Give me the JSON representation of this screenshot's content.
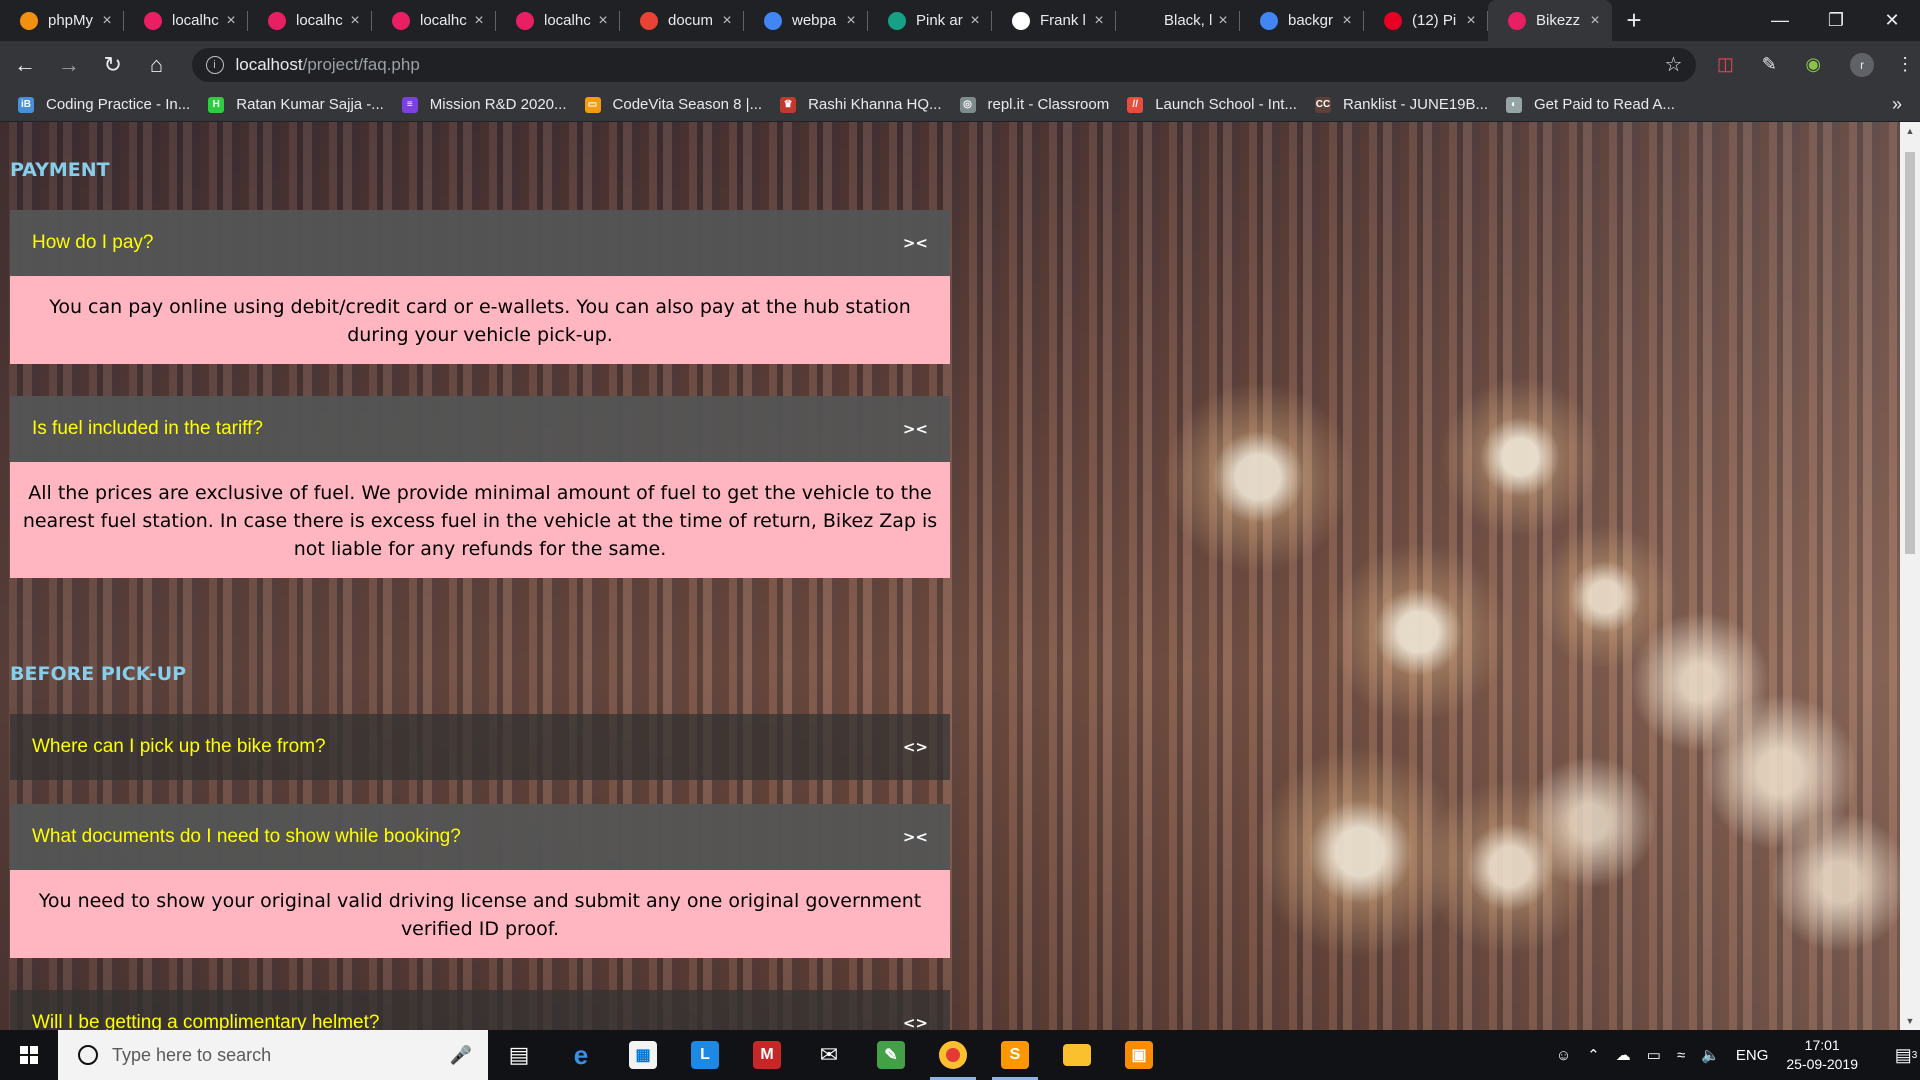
{
  "browser": {
    "tabs": [
      {
        "title": "phpMy",
        "icon": "phpmyadmin-icon",
        "color": "#f29111"
      },
      {
        "title": "localhc",
        "icon": "localhost-icon",
        "color": "#e91e63"
      },
      {
        "title": "localhc",
        "icon": "localhost-icon",
        "color": "#e91e63"
      },
      {
        "title": "localhc",
        "icon": "localhost-icon",
        "color": "#e91e63"
      },
      {
        "title": "localhc",
        "icon": "localhost-icon",
        "color": "#e91e63"
      },
      {
        "title": "docum",
        "icon": "gmail-icon",
        "color": "#ea4335"
      },
      {
        "title": "webpa",
        "icon": "google-icon",
        "color": "#4285f4"
      },
      {
        "title": "Pink ar",
        "icon": "docs-icon",
        "color": "#16a085"
      },
      {
        "title": "Frank l",
        "icon": "bookmark-icon",
        "color": "#ffffff"
      },
      {
        "title": "Black, l",
        "icon": "blank-icon",
        "color": "#202124"
      },
      {
        "title": "backgr",
        "icon": "google-icon",
        "color": "#4285f4"
      },
      {
        "title": "(12) Pi",
        "icon": "pinterest-icon",
        "color": "#e60023"
      },
      {
        "title": "Bikezz",
        "icon": "localhost-icon",
        "color": "#e91e63"
      }
    ],
    "url_host": "localhost",
    "url_path": "/project/faq.php",
    "profile_initial": "r",
    "bookmarks": [
      {
        "label": "Coding Practice - In...",
        "color": "#4a90d9",
        "glyph": "iB"
      },
      {
        "label": "Ratan Kumar Sajja -...",
        "color": "#2ecc40",
        "glyph": "H"
      },
      {
        "label": "Mission R&D 2020...",
        "color": "#7b3fe4",
        "glyph": "≡"
      },
      {
        "label": "CodeVita Season 8 |...",
        "color": "#f39c12",
        "glyph": "▭"
      },
      {
        "label": "Rashi Khanna HQ...",
        "color": "#c0392b",
        "glyph": "♛"
      },
      {
        "label": "repl.it - Classroom",
        "color": "#7f8c8d",
        "glyph": "◎"
      },
      {
        "label": "Launch School - Int...",
        "color": "#e74c3c",
        "glyph": "//"
      },
      {
        "label": "Ranklist - JUNE19B...",
        "color": "#5d4037",
        "glyph": "CC"
      },
      {
        "label": "Get Paid to Read A...",
        "color": "#95a5a6",
        "glyph": "◐"
      }
    ]
  },
  "faq": {
    "sections": [
      {
        "title": "PAYMENT",
        "items": [
          {
            "question": "How do I pay?",
            "toggle": "><",
            "expanded": true,
            "answer": "You can pay online using debit/credit card or e-wallets. You can also pay at the hub station during your vehicle pick-up."
          },
          {
            "question": "Is fuel included in the tariff?",
            "toggle": "><",
            "expanded": true,
            "answer": "All the prices are exclusive of fuel. We provide minimal amount of fuel to get the vehicle to the nearest fuel station. In case there is excess fuel in the vehicle at the time of return, Bikez Zap is not liable for any refunds for the same."
          }
        ]
      },
      {
        "title": "BEFORE PICK-UP",
        "items": [
          {
            "question": "Where can I pick up the bike from?",
            "toggle": "<>",
            "expanded": false
          },
          {
            "question": "What documents do I need to show while booking?",
            "toggle": "><",
            "expanded": true,
            "answer": "You need to show your original valid driving license and submit any one original government verified ID proof."
          },
          {
            "question": "Will I be getting a complimentary helmet?",
            "toggle": "<>",
            "expanded": false
          }
        ]
      }
    ]
  },
  "taskbar": {
    "search_placeholder": "Type here to search",
    "language": "ENG",
    "time": "17:01",
    "date": "25-09-2019",
    "notification_count": "3"
  }
}
